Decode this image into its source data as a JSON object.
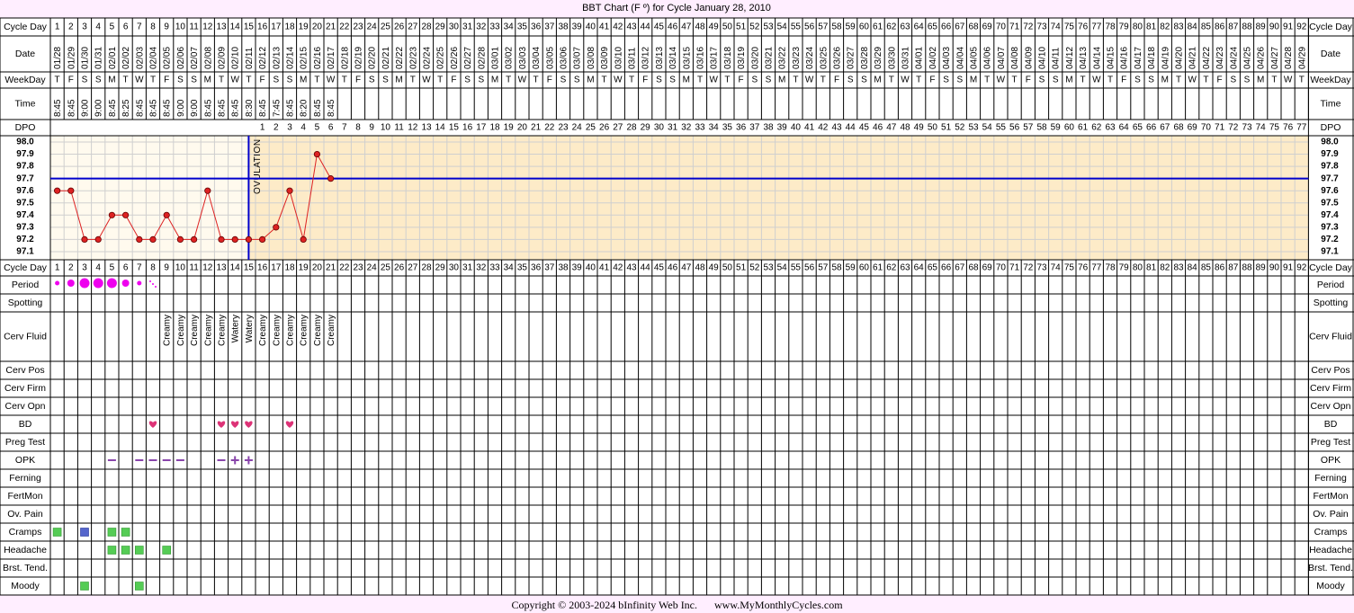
{
  "title": "BBT Chart (F º) for Cycle January 28, 2010",
  "footer": {
    "copyright": "Copyright © 2003-2024 bInfinity Web Inc.",
    "site": "www.MyMonthlyCycles.com"
  },
  "row_labels": {
    "cycle_day": "Cycle Day",
    "date": "Date",
    "weekday": "WeekDay",
    "time": "Time",
    "dpo": "DPO",
    "period": "Period",
    "spotting": "Spotting",
    "cerv_fluid": "Cerv Fluid",
    "cerv_pos": "Cerv Pos",
    "cerv_firm": "Cerv Firm",
    "cerv_opn": "Cerv Opn",
    "bd": "BD",
    "preg_test": "Preg Test",
    "opk": "OPK",
    "ferning": "Ferning",
    "fertmon": "FertMon",
    "ov_pain": "Ov. Pain",
    "cramps": "Cramps",
    "headache": "Headache",
    "brst_tend": "Brst. Tend.",
    "moody": "Moody"
  },
  "colors": {
    "page_bg": "#ffeeff",
    "pre_ov_bg": "#fffaee",
    "post_ov_bg": "#fdebc8",
    "temp_line": "#dd2222",
    "coverline": "#0000cc",
    "period": "#ee00ee",
    "bd_heart": "#dd3377",
    "opk": "#8844aa",
    "symptom_green": "#55cc55",
    "symptom_blue": "#5566cc"
  },
  "chart_data": {
    "type": "line",
    "title": "BBT Chart (F º) for Cycle January 28, 2010",
    "cycle_days": 92,
    "dates": [
      "01/28",
      "01/29",
      "01/30",
      "01/31",
      "02/01",
      "02/02",
      "02/03",
      "02/04",
      "02/05",
      "02/06",
      "02/07",
      "02/08",
      "02/09",
      "02/10",
      "02/11",
      "02/12",
      "02/13",
      "02/14",
      "02/15",
      "02/16",
      "02/17",
      "02/18",
      "02/19",
      "02/20",
      "02/21",
      "02/22",
      "02/23",
      "02/24",
      "02/25",
      "02/26",
      "02/27",
      "02/28",
      "03/01",
      "03/02",
      "03/03",
      "03/04",
      "03/05",
      "03/06",
      "03/07",
      "03/08",
      "03/09",
      "03/10",
      "03/11",
      "03/12",
      "03/13",
      "03/14",
      "03/15",
      "03/16",
      "03/17",
      "03/18",
      "03/19",
      "03/20",
      "03/21",
      "03/22",
      "03/23",
      "03/24",
      "03/25",
      "03/26",
      "03/27",
      "03/28",
      "03/29",
      "03/30",
      "03/31",
      "04/01",
      "04/02",
      "04/03",
      "04/04",
      "04/05",
      "04/06",
      "04/07",
      "04/08",
      "04/09",
      "04/10",
      "04/11",
      "04/12",
      "04/13",
      "04/14",
      "04/15",
      "04/16",
      "04/17",
      "04/18",
      "04/19",
      "04/20",
      "04/21",
      "04/22",
      "04/23",
      "04/24",
      "04/25",
      "04/26",
      "04/27",
      "04/28",
      "04/29"
    ],
    "weekdays": [
      "T",
      "F",
      "S",
      "S",
      "M",
      "T",
      "W",
      "T",
      "F",
      "S",
      "S",
      "M",
      "T",
      "W",
      "T",
      "F",
      "S",
      "S",
      "M",
      "T",
      "W",
      "T",
      "F",
      "S",
      "S",
      "M",
      "T",
      "W",
      "T",
      "F",
      "S",
      "S",
      "M",
      "T",
      "W",
      "T",
      "F",
      "S",
      "S",
      "M",
      "T",
      "W",
      "T",
      "F",
      "S",
      "S",
      "M",
      "T",
      "W",
      "T",
      "F",
      "S",
      "S",
      "M",
      "T",
      "W",
      "T",
      "F",
      "S",
      "S",
      "M",
      "T",
      "W",
      "T",
      "F",
      "S",
      "S",
      "M",
      "T",
      "W",
      "T",
      "F",
      "S",
      "S",
      "M",
      "T",
      "W",
      "T",
      "F",
      "S",
      "S",
      "M",
      "T",
      "W",
      "T",
      "F",
      "S",
      "S",
      "M",
      "T",
      "W",
      "T"
    ],
    "times": [
      "8:45",
      "8:45",
      "9:00",
      "9:00",
      "8:45",
      "8:25",
      "8:45",
      "8:45",
      "8:45",
      "9:00",
      "9:00",
      "8:45",
      "8:45",
      "8:45",
      "8:30",
      "8:45",
      "7:45",
      "8:45",
      "8:20",
      "8:45",
      "8:45"
    ],
    "temperatures": [
      97.6,
      97.6,
      97.2,
      97.2,
      97.4,
      97.4,
      97.2,
      97.2,
      97.4,
      97.2,
      97.2,
      97.6,
      97.2,
      97.2,
      97.2,
      97.2,
      97.3,
      97.6,
      97.2,
      97.9,
      97.7
    ],
    "y_ticks": [
      "98.0",
      "97.9",
      "97.8",
      "97.7",
      "97.6",
      "97.5",
      "97.4",
      "97.3",
      "97.2",
      "97.1"
    ],
    "ylim": [
      97.1,
      98.0
    ],
    "coverline": 97.7,
    "ovulation_day": 15,
    "ovulation_label": "OVULATION",
    "dpo_start_day": 16,
    "dpo_count": 77,
    "period": [
      {
        "day": 1,
        "level": "light"
      },
      {
        "day": 2,
        "level": "medium"
      },
      {
        "day": 3,
        "level": "heavy"
      },
      {
        "day": 4,
        "level": "heavy"
      },
      {
        "day": 5,
        "level": "heavy"
      },
      {
        "day": 6,
        "level": "medium"
      },
      {
        "day": 7,
        "level": "light"
      },
      {
        "day": 8,
        "level": "spotting"
      }
    ],
    "cerv_fluid": [
      {
        "day": 9,
        "value": "Creamy"
      },
      {
        "day": 10,
        "value": "Creamy"
      },
      {
        "day": 11,
        "value": "Creamy"
      },
      {
        "day": 12,
        "value": "Creamy"
      },
      {
        "day": 13,
        "value": "Creamy"
      },
      {
        "day": 14,
        "value": "Watery"
      },
      {
        "day": 15,
        "value": "Watery"
      },
      {
        "day": 16,
        "value": "Creamy"
      },
      {
        "day": 17,
        "value": "Creamy"
      },
      {
        "day": 18,
        "value": "Creamy"
      },
      {
        "day": 19,
        "value": "Creamy"
      },
      {
        "day": 20,
        "value": "Creamy"
      },
      {
        "day": 21,
        "value": "Creamy"
      }
    ],
    "bd_days": [
      8,
      13,
      14,
      15,
      18
    ],
    "opk": [
      {
        "day": 5,
        "result": "−"
      },
      {
        "day": 7,
        "result": "−"
      },
      {
        "day": 8,
        "result": "−"
      },
      {
        "day": 9,
        "result": "−"
      },
      {
        "day": 10,
        "result": "−"
      },
      {
        "day": 13,
        "result": "−"
      },
      {
        "day": 14,
        "result": "+"
      },
      {
        "day": 15,
        "result": "+"
      }
    ],
    "symptoms": {
      "cramps": [
        {
          "day": 1,
          "color": "green"
        },
        {
          "day": 3,
          "color": "blue"
        },
        {
          "day": 5,
          "color": "green"
        },
        {
          "day": 6,
          "color": "green"
        }
      ],
      "headache": [
        {
          "day": 5,
          "color": "green"
        },
        {
          "day": 6,
          "color": "green"
        },
        {
          "day": 7,
          "color": "green"
        },
        {
          "day": 9,
          "color": "green"
        }
      ],
      "moody": [
        {
          "day": 3,
          "color": "green"
        },
        {
          "day": 7,
          "color": "green"
        }
      ]
    }
  }
}
